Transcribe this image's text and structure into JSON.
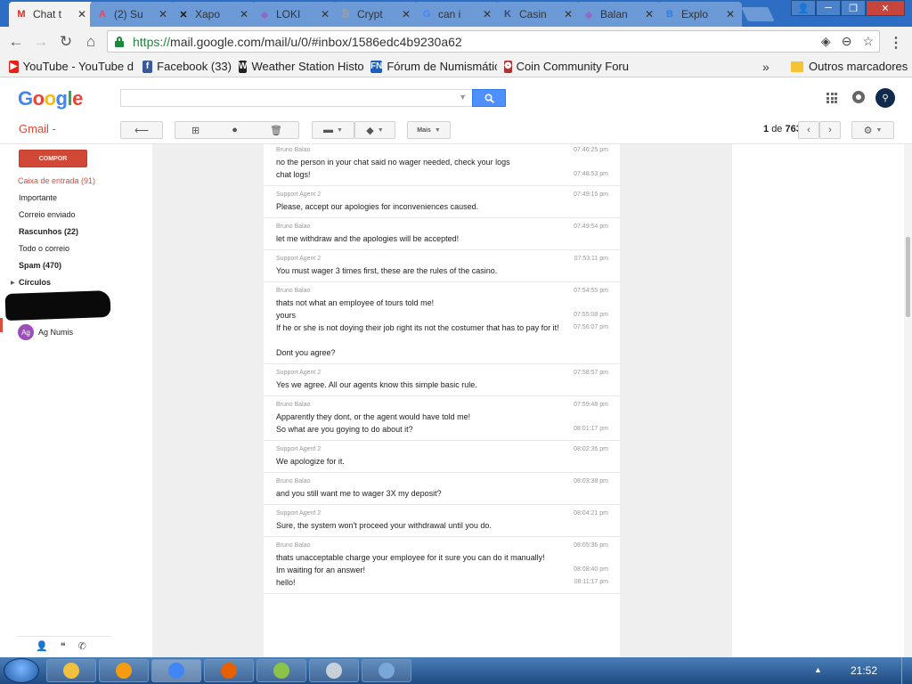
{
  "browser": {
    "tabs": [
      {
        "title": "Chat t",
        "favicon": "gmail-icon",
        "fav_text": "M",
        "fav_color": "#d93025",
        "active": true
      },
      {
        "title": "(2) Su",
        "favicon": "support-icon",
        "fav_text": "A",
        "fav_color": "#e04a5f"
      },
      {
        "title": "Xapo",
        "favicon": "xapo-icon",
        "fav_text": "✕",
        "fav_color": "#111111"
      },
      {
        "title": "LOKI",
        "favicon": "purple-gem-icon",
        "fav_text": "◆",
        "fav_color": "#8e6bc7"
      },
      {
        "title": "Crypt",
        "favicon": "bitcoin-icon",
        "fav_text": "₿",
        "fav_color": "#9aa0a6"
      },
      {
        "title": "can i",
        "favicon": "google-icon",
        "fav_text": "G",
        "fav_color": "#4285f4"
      },
      {
        "title": "Casin",
        "favicon": "k-icon",
        "fav_text": "K",
        "fav_color": "#3c4a6e"
      },
      {
        "title": "Balan",
        "favicon": "purple-gem-icon",
        "fav_text": "◆",
        "fav_color": "#8e6bc7"
      },
      {
        "title": "Explo",
        "favicon": "explorer-icon",
        "fav_text": "B",
        "fav_color": "#2f7de1"
      }
    ],
    "window_controls": [
      "👤",
      "─",
      "❐",
      "✕"
    ],
    "url_https": "https://",
    "url_rest": "mail.google.com/mail/u/0/#inbox/1586edc4b9230a62",
    "bookmarks": [
      {
        "label": "YouTube - YouTube d",
        "icon": "youtube-icon",
        "fav_text": "▶",
        "fav_color": "#e62117"
      },
      {
        "label": "Facebook (33)",
        "icon": "facebook-icon",
        "fav_text": "f",
        "fav_color": "#3b5998"
      },
      {
        "label": "Weather Station Histo",
        "icon": "weather-icon",
        "fav_text": "W",
        "fav_color": "#222222"
      },
      {
        "label": "Fórum de Numismátic",
        "icon": "fn-icon",
        "fav_text": "FN",
        "fav_color": "#1c5fb8"
      },
      {
        "label": "Coin Community Foru",
        "icon": "coin-community-icon",
        "fav_text": "❁",
        "fav_color": "#b03030"
      }
    ],
    "bookmarks_overflow": "»",
    "other_bookmarks": "Outros marcadores"
  },
  "gmail": {
    "logo_letters": [
      {
        "ch": "G",
        "color": "#4285f4"
      },
      {
        "ch": "o",
        "color": "#ea4335"
      },
      {
        "ch": "o",
        "color": "#fbbc05"
      },
      {
        "ch": "g",
        "color": "#4285f4"
      },
      {
        "ch": "l",
        "color": "#34a853"
      },
      {
        "ch": "e",
        "color": "#ea4335"
      }
    ],
    "label": "Gmail -",
    "more_button": "Mais",
    "pager": {
      "current": "1",
      "of_label": "de",
      "total": "763"
    },
    "compose": "COMPOR",
    "nav": [
      {
        "label": "Caixa de entrada (91)",
        "active": true
      },
      {
        "label": "Importante"
      },
      {
        "label": "Correio enviado"
      },
      {
        "label": "Rascunhos (22)",
        "bold": true
      },
      {
        "label": "Todo o correio"
      },
      {
        "label": "Spam (470)",
        "bold": true
      },
      {
        "label": "Círculos",
        "bold": true
      }
    ],
    "contact": {
      "initials": "Ag",
      "name": "Ag Numis"
    }
  },
  "messages": [
    {
      "sender": "Bruno Balao",
      "lines": [
        {
          "text": "no the person in your chat said no wager needed, check your logs",
          "time": "07:46:25 pm"
        },
        {
          "text": "chat logs!",
          "time": "07:48:53 pm"
        }
      ]
    },
    {
      "sender": "Support Agent 2",
      "lines": [
        {
          "text": "Please, accept our apologies for inconveniences caused.",
          "time": "07:49:15 pm"
        }
      ]
    },
    {
      "sender": "Bruno Balao",
      "lines": [
        {
          "text": "let me withdraw and the apologies will be accepted!",
          "time": "07:49:54 pm"
        }
      ]
    },
    {
      "sender": "Support Agent 2",
      "lines": [
        {
          "text": "You must wager 3 times first, these are the rules of the casino.",
          "time": "07:53:11 pm"
        }
      ]
    },
    {
      "sender": "Bruno Balao",
      "lines": [
        {
          "text": "thats not what an employee of tours told me!",
          "time": "07:54:55 pm"
        },
        {
          "text": "yours",
          "time": "07:55:08 pm"
        },
        {
          "text": "If he or she is not doying their job right its not the costumer that has to pay for it!",
          "time": "07:56:07 pm"
        },
        {
          "text": "Dont you agree?",
          "time": ""
        }
      ]
    },
    {
      "sender": "Support Agent 2",
      "lines": [
        {
          "text": "Yes we agree. All our agents know this simple basic rule.",
          "time": "07:58:57 pm"
        }
      ]
    },
    {
      "sender": "Bruno Balao",
      "lines": [
        {
          "text": "Apparently they dont, or the agent would have told me!",
          "time": "07:59:48 pm"
        },
        {
          "text": "So what are you goying to do about it?",
          "time": "08:01:17 pm"
        }
      ]
    },
    {
      "sender": "Support Agent 2",
      "lines": [
        {
          "text": "We apologize for it.",
          "time": "08:02:36 pm"
        }
      ]
    },
    {
      "sender": "Bruno Balao",
      "lines": [
        {
          "text": "and you still want me to wager 3X my deposit?",
          "time": "08:03:38 pm"
        }
      ]
    },
    {
      "sender": "Support Agent 2",
      "lines": [
        {
          "text": "Sure, the system won't proceed your withdrawal until you do.",
          "time": "08:04:21 pm"
        }
      ]
    },
    {
      "sender": "Bruno Balao",
      "lines": [
        {
          "text": "thats unacceptable charge your employee for it sure you can do it manually!",
          "time": "08:05:36 pm"
        },
        {
          "text": "Im waiting for an answer!",
          "time": "08:08:40 pm"
        },
        {
          "text": "hello!",
          "time": "08:11:17 pm"
        }
      ]
    }
  ],
  "taskbar": {
    "apps": [
      "explorer-icon",
      "media-player-icon",
      "chrome-icon",
      "firefox-icon",
      "app-icon",
      "calculator-icon",
      "paint-icon"
    ],
    "tray_arrow": "▲",
    "clock": "21:52"
  }
}
